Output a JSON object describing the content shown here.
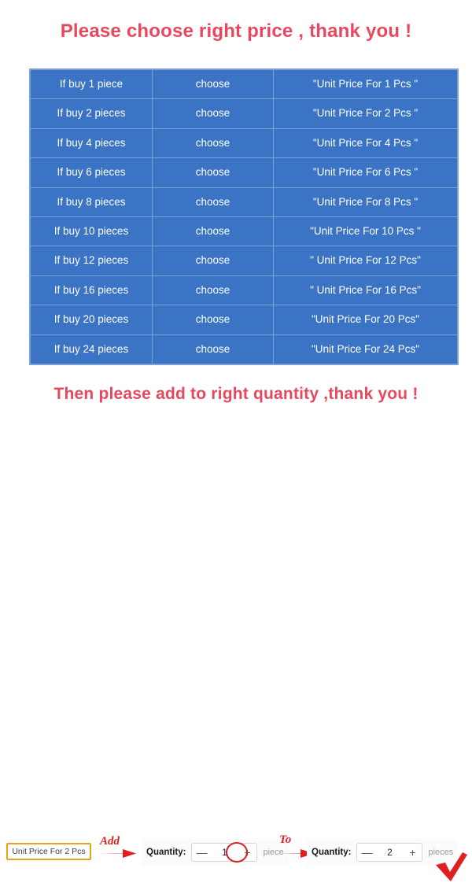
{
  "headings": {
    "top": "Please choose right price , thank you !",
    "bottom": "Then please add to right quantity ,thank you !"
  },
  "colors": {
    "heading_red": "#e8485e",
    "table_blue": "#3b74c4",
    "table_border": "#7ba2d8",
    "annotation_red": "#e02020",
    "chip_border_orange": "#e8a317",
    "highlight_red": "#d61f26"
  },
  "price_table": {
    "rows": [
      {
        "quantity": "If buy  1  piece",
        "action": "choose",
        "unit_price": "\"Unit Price For  1  Pcs \""
      },
      {
        "quantity": "If buy  2  pieces",
        "action": "choose",
        "unit_price": "\"Unit Price For  2  Pcs \""
      },
      {
        "quantity": "If buy  4  pieces",
        "action": "choose",
        "unit_price": "\"Unit Price For  4 Pcs \""
      },
      {
        "quantity": "If buy  6  pieces",
        "action": "choose",
        "unit_price": "\"Unit Price For  6  Pcs \""
      },
      {
        "quantity": "If  buy  8  pieces",
        "action": "choose",
        "unit_price": "\"Unit Price For  8  Pcs \""
      },
      {
        "quantity": "If buy  10  pieces",
        "action": "choose",
        "unit_price": "\"Unit Price For  10  Pcs \""
      },
      {
        "quantity": "If buy  12  pieces",
        "action": "choose",
        "unit_price": "\" Unit Price For  12 Pcs\""
      },
      {
        "quantity": "If buy  16  pieces",
        "action": "choose",
        "unit_price": "\" Unit Price For  16  Pcs\""
      },
      {
        "quantity": "If buy  20  pieces",
        "action": "choose",
        "unit_price": "\"Unit Price For  20  Pcs\""
      },
      {
        "quantity": "If buy  24  pieces",
        "action": "choose",
        "unit_price": "\"Unit Price For  24  Pcs\""
      }
    ]
  },
  "bottom_demo": {
    "sku_chip": "Unit Price For 2 Pcs",
    "annotation_add": "Add",
    "annotation_to": "To",
    "before": {
      "label": "Quantity:",
      "minus": "—",
      "value": "1",
      "plus": "+",
      "unit": "piece"
    },
    "after": {
      "label": "Quantity:",
      "minus": "—",
      "value": "2",
      "plus": "+",
      "unit": "pieces"
    }
  }
}
